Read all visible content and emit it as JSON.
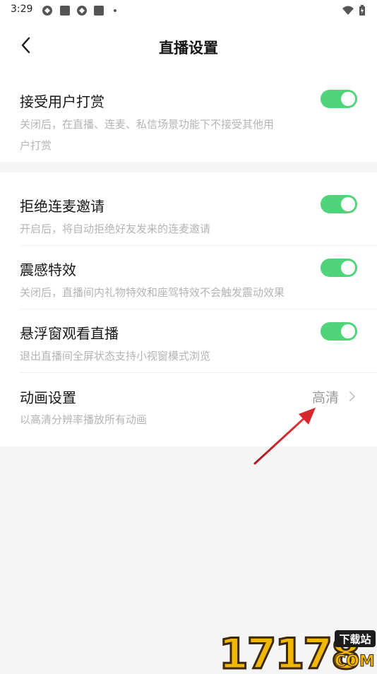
{
  "status_bar": {
    "time": "3:29"
  },
  "header": {
    "title": "直播设置"
  },
  "settings": {
    "reward": {
      "title": "接受用户打赏",
      "desc_line1": "关闭后，在直播、连麦、私信场景功能下不接受其他用",
      "desc_line2": "户打赏",
      "enabled": true
    },
    "reject_invite": {
      "title": "拒绝连麦邀请",
      "desc": "开启后，将自动拒绝好友发来的连麦邀请",
      "enabled": true
    },
    "vibration": {
      "title": "震感特效",
      "desc": "关闭后，直播间内礼物特效和座驾特效不会触发震动效果",
      "enabled": true
    },
    "floating_window": {
      "title": "悬浮窗观看直播",
      "desc": "退出直播间全屏状态支持小视窗模式浏览",
      "enabled": true
    },
    "animation": {
      "title": "动画设置",
      "value": "高清",
      "desc": "以高清分辨率播放所有动画"
    }
  },
  "watermark": {
    "logo": "17178",
    "badge": "下载站",
    "domain": "COM"
  },
  "colors": {
    "toggle_on": "#4fd47a",
    "annotation_arrow": "#d8262c"
  }
}
